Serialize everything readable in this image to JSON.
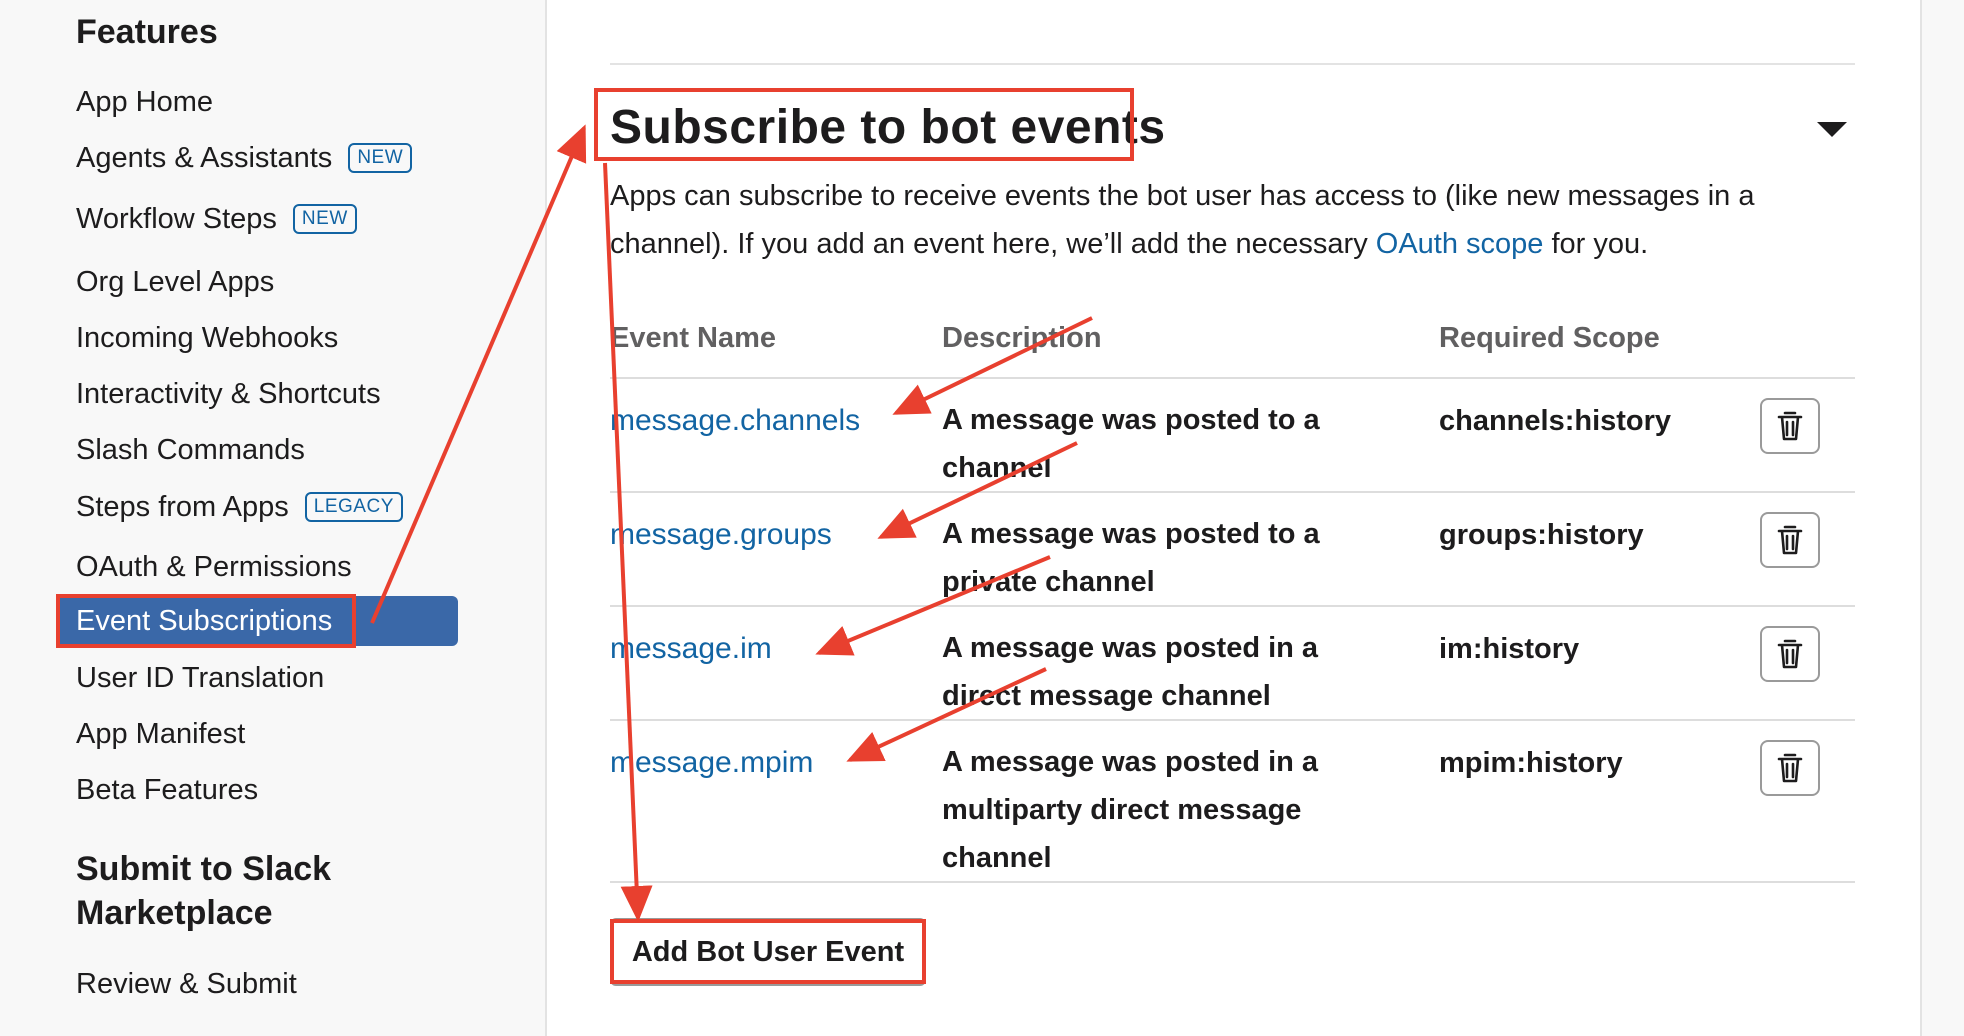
{
  "sidebar": {
    "features_heading": "Features",
    "items": [
      {
        "label": "App Home",
        "badge": ""
      },
      {
        "label": "Agents & Assistants",
        "badge": "NEW"
      },
      {
        "label": "Workflow Steps",
        "badge": "NEW"
      },
      {
        "label": "Org Level Apps",
        "badge": ""
      },
      {
        "label": "Incoming Webhooks",
        "badge": ""
      },
      {
        "label": "Interactivity & Shortcuts",
        "badge": ""
      },
      {
        "label": "Slash Commands",
        "badge": ""
      },
      {
        "label": "Steps from Apps",
        "badge": "LEGACY"
      },
      {
        "label": "OAuth & Permissions",
        "badge": ""
      },
      {
        "label": "Event Subscriptions",
        "badge": "",
        "active": true
      },
      {
        "label": "User ID Translation",
        "badge": ""
      },
      {
        "label": "App Manifest",
        "badge": ""
      },
      {
        "label": "Beta Features",
        "badge": ""
      }
    ],
    "submit_heading_line1": "Submit to Slack",
    "submit_heading_line2": "Marketplace",
    "submit_items": [
      {
        "label": "Review & Submit"
      }
    ]
  },
  "section": {
    "title": "Subscribe to bot events",
    "desc_before_link": "Apps can subscribe to receive events the bot user has access to (like new messages in a channel). If you add an event here, we’ll add the necessary ",
    "desc_link": "OAuth scope",
    "desc_after_link": " for you."
  },
  "table": {
    "headers": {
      "name": "Event Name",
      "description": "Description",
      "scope": "Required Scope"
    },
    "rows": [
      {
        "name": "message.channels",
        "description": "A message was posted to a channel",
        "scope": "channels:history"
      },
      {
        "name": "message.groups",
        "description": "A message was posted to a private channel",
        "scope": "groups:history"
      },
      {
        "name": "message.im",
        "description": "A message was posted in a direct message channel",
        "scope": "im:history"
      },
      {
        "name": "message.mpim",
        "description": "A message was posted in a multiparty direct message channel",
        "scope": "mpim:history"
      }
    ]
  },
  "add_button_label": "Add Bot User Event",
  "icons": {
    "collapse": "caret-down-icon",
    "delete": "trash-icon"
  },
  "colors": {
    "link": "#1264a3",
    "active_nav": "#3a68a8",
    "annotation": "#e8402f"
  }
}
